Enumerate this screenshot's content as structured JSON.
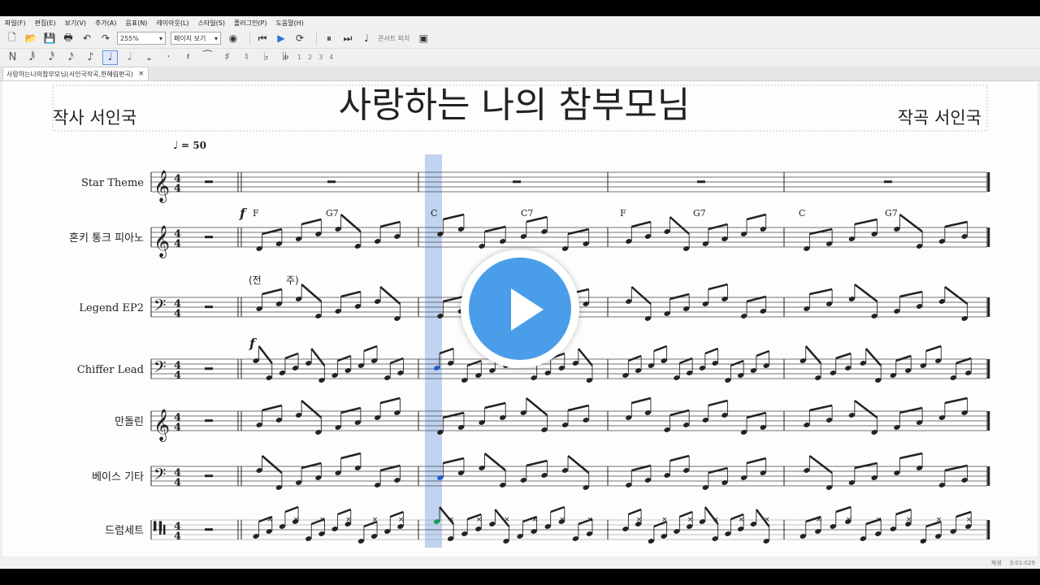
{
  "menu": [
    "파일(F)",
    "편집(E)",
    "보기(V)",
    "추가(A)",
    "음표(N)",
    "레이아웃(L)",
    "스타일(S)",
    "플러그인(P)",
    "도움말(H)"
  ],
  "toolbar": {
    "zoom": "255%",
    "view_mode": "페이지 보기",
    "concert_pitch": "콘서트 피치",
    "voice_numbers": [
      "1",
      "2",
      "3",
      "4"
    ]
  },
  "tab": {
    "title": "사랑하는나의참부모님(서인국작곡,한혜림편곡)",
    "close": "×"
  },
  "score": {
    "title": "사랑하는 나의 참부모님",
    "lyricist": "작사 서인국",
    "composer": "작곡 서인국",
    "tempo": "= 50",
    "intro_lyric": [
      "(전",
      "주)"
    ],
    "dynamics": [
      "f",
      "f"
    ],
    "chords": [
      "F",
      "G7",
      "C",
      "C7",
      "F",
      "G7",
      "C",
      "G7"
    ],
    "instruments": [
      "Star Theme",
      "혼키 통크 피아노",
      "Legend EP2",
      "Chiffer Lead",
      "만돌린",
      "베이스 기타",
      "드럼세트"
    ],
    "time_signature": [
      "4",
      "4"
    ]
  },
  "status": {
    "mode": "재생",
    "time": "3:01:029"
  },
  "colors": {
    "playhead": "#8fb0e8",
    "play_button": "#4a9de8",
    "selected_note": "#1f5fd0",
    "drum_note": "#14a05a"
  }
}
